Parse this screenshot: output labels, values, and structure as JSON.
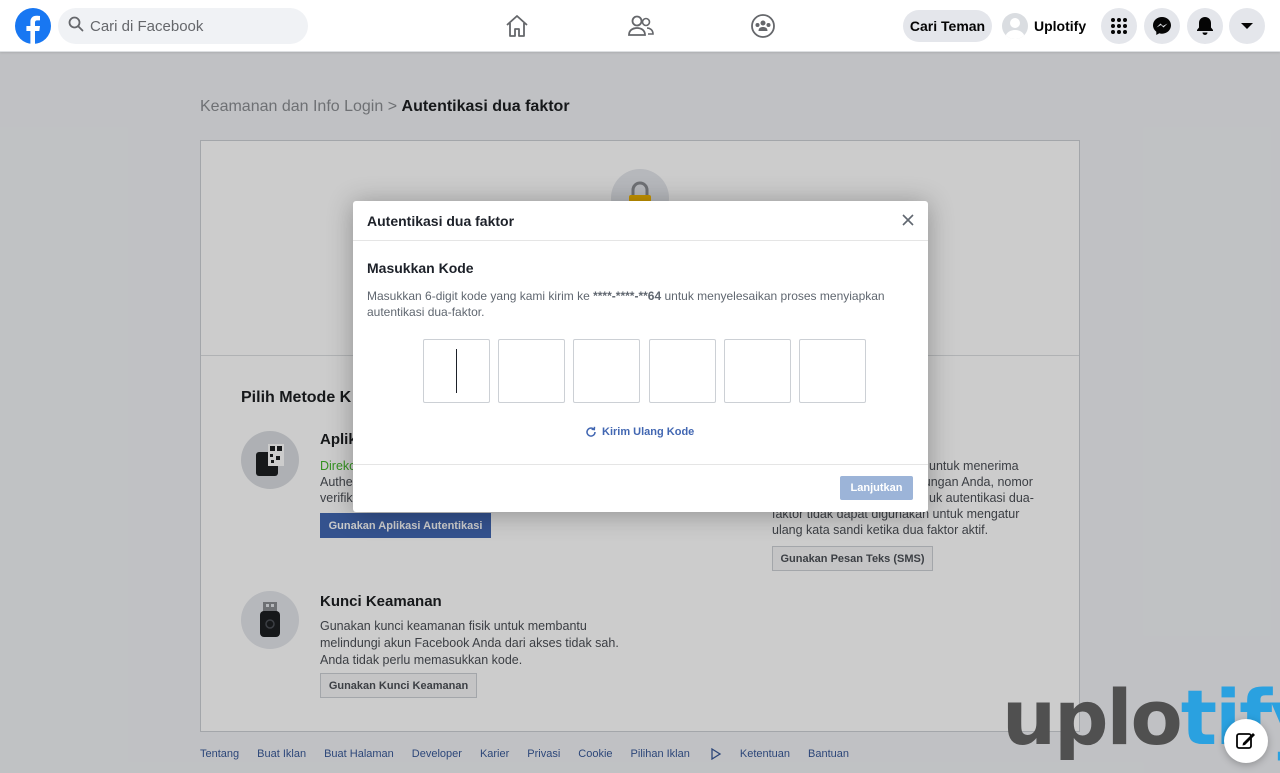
{
  "topbar": {
    "search_placeholder": "Cari di Facebook",
    "find_friends_label": "Cari Teman",
    "profile_name": "Uplotify"
  },
  "breadcrumb": {
    "parent": "Keamanan dan Info Login",
    "separator": ">",
    "current": "Autentikasi dua faktor"
  },
  "page": {
    "section_title": "Pilih Metode K",
    "auth_app": {
      "title": "Aplik",
      "recommended": "Direko",
      "desc_line1": "Authe",
      "desc_line2": "verifik",
      "button_label": "Gunakan Aplikasi Autentikasi"
    },
    "sms": {
      "desc_line1": "untuk menerima",
      "desc_line2": "jungan Anda, nomor",
      "desc_line3": "uk autentikasi dua-",
      "desc_line4": "faktor tidak dapat digunakan untuk mengatur",
      "desc_line5": "ulang kata sandi ketika dua faktor aktif.",
      "button_label": "Gunakan Pesan Teks (SMS)"
    },
    "security_key": {
      "title": "Kunci Keamanan",
      "desc_line1": "Gunakan kunci keamanan fisik untuk membantu",
      "desc_line2": "melindungi akun Facebook Anda dari akses tidak sah.",
      "desc_line3": "Anda tidak perlu memasukkan kode.",
      "button_label": "Gunakan Kunci Keamanan"
    }
  },
  "footer": {
    "links": [
      "Tentang",
      "Buat Iklan",
      "Buat Halaman",
      "Developer",
      "Karier",
      "Privasi",
      "Cookie",
      "Pilihan Iklan",
      "Ketentuan",
      "Bantuan"
    ]
  },
  "modal": {
    "title": "Autentikasi dua faktor",
    "subtitle": "Masukkan Kode",
    "desc_before": "Masukkan 6-digit kode yang kami kirim ke ",
    "masked_number": "****-****-**64",
    "desc_after": " untuk menyelesaikan proses menyiapkan autentikasi dua-faktor.",
    "code_digits": [
      "",
      "",
      "",
      "",
      "",
      ""
    ],
    "resend_label": "Kirim Ulang Kode",
    "continue_label": "Lanjutkan"
  },
  "watermark": {
    "part1": "uplo",
    "part2": "tify"
  },
  "colors": {
    "brand": "#1877f2",
    "link": "#4267b2",
    "button_disabled": "#9cb4d8",
    "green": "#42b72a"
  }
}
